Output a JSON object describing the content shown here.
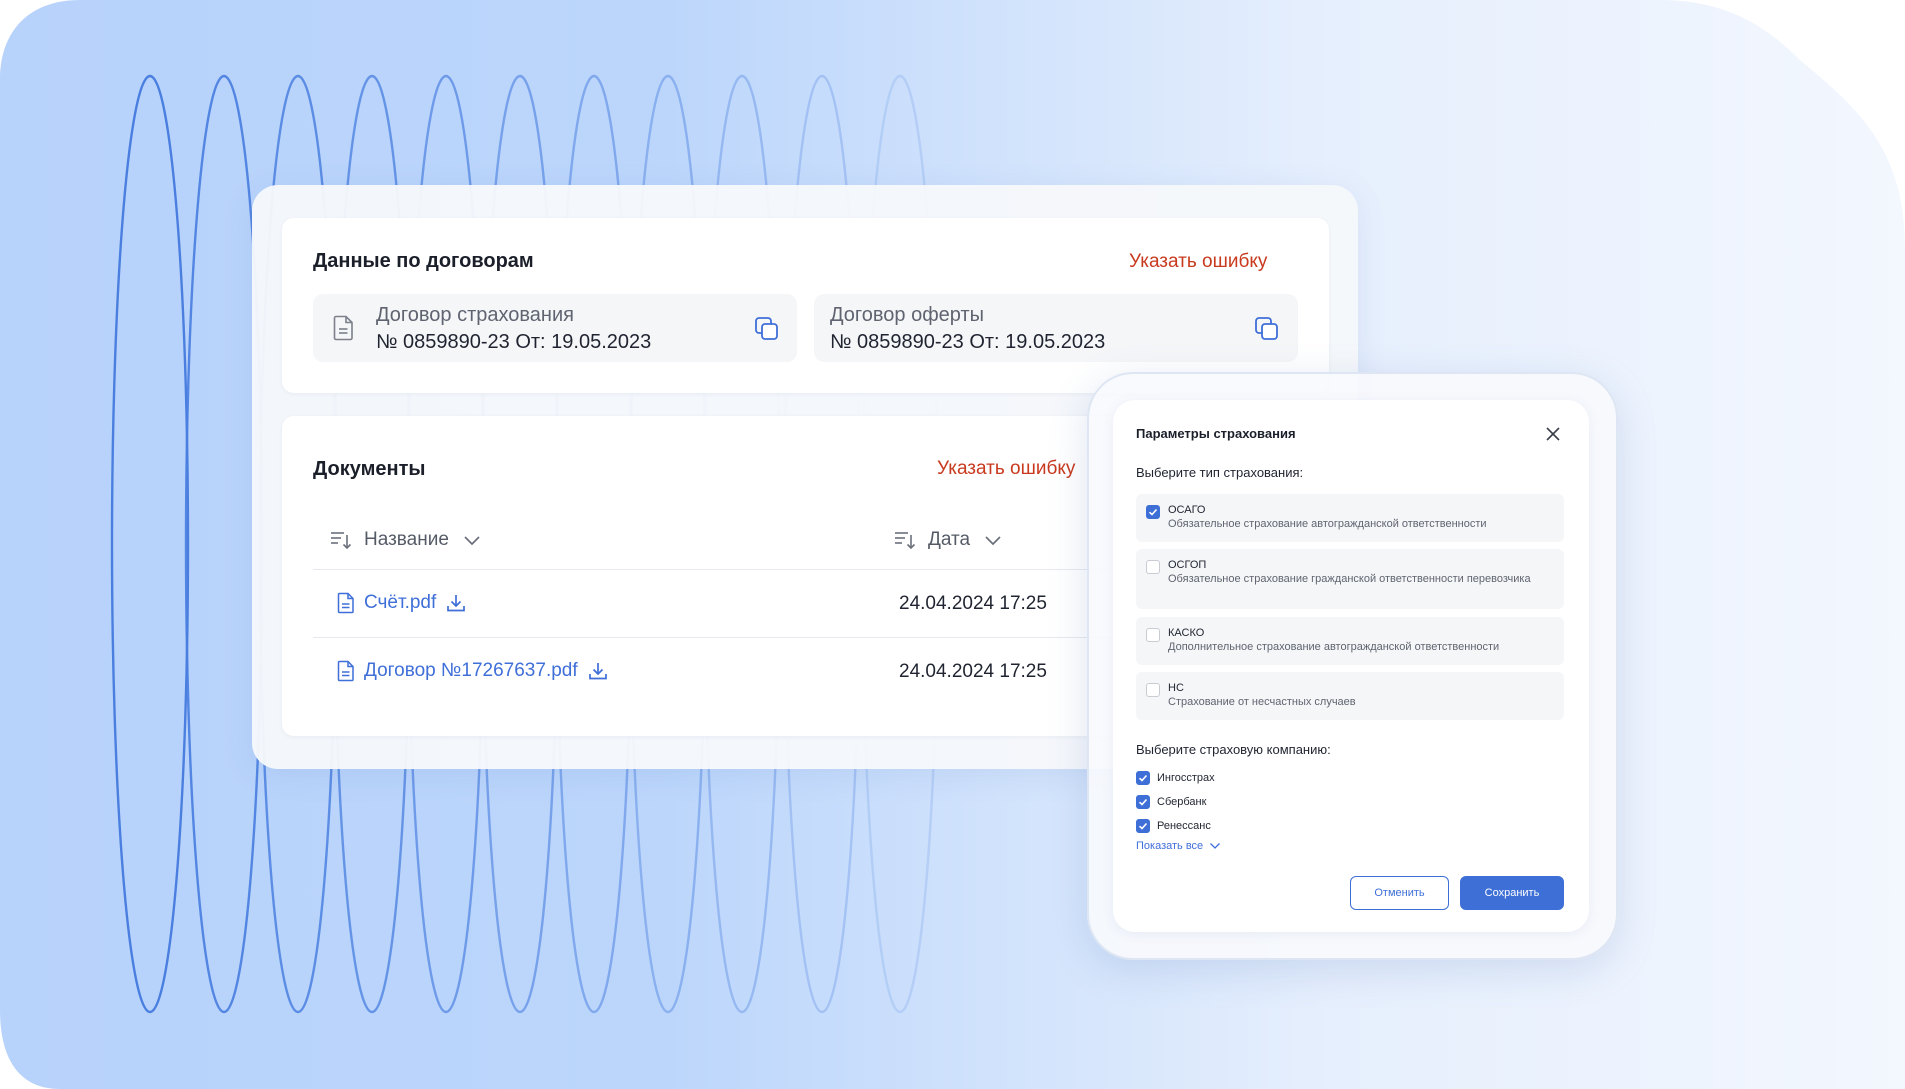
{
  "theme": {
    "accent": "#3d6fd6",
    "link": "#3f6fd8",
    "danger_link": "#c8391e",
    "bg_blue": "#b9d4fb"
  },
  "contracts": {
    "title": "Данные по договорам",
    "report_label": "Указать ошибку",
    "items": [
      {
        "icon": "document-icon",
        "title": "Договор страхования",
        "value": "№ 0859890-23 От: 19.05.2023"
      },
      {
        "title": "Договор оферты",
        "value": "№ 0859890-23 От: 19.05.2023"
      }
    ]
  },
  "documents": {
    "title": "Документы",
    "report_label": "Указать ошибку",
    "columns": {
      "name": "Название",
      "date": "Дата"
    },
    "rows": [
      {
        "name": "Счёт.pdf",
        "date": "24.04.2024 17:25"
      },
      {
        "name": "Договор №17267637.pdf",
        "date": "24.04.2024 17:25"
      }
    ]
  },
  "modal": {
    "title": "Параметры страхования",
    "type_prompt": "Выберите тип страхования:",
    "types": [
      {
        "name": "ОСАГО",
        "desc": "Обязательное страхование автогражданской ответственности",
        "checked": true
      },
      {
        "name": "ОСГОП",
        "desc": "Обязательное страхование гражданской ответственности перевозчика",
        "checked": false
      },
      {
        "name": "КАСКО",
        "desc": "Дополнительное страхование автогражданской ответственности",
        "checked": false
      },
      {
        "name": "НС",
        "desc": "Страхование от несчастных случаев",
        "checked": false
      }
    ],
    "company_prompt": "Выберите страховую компанию:",
    "companies": [
      {
        "name": "Ингосстрах",
        "checked": true
      },
      {
        "name": "Сбербанк",
        "checked": true
      },
      {
        "name": "Ренессанс",
        "checked": true
      }
    ],
    "show_all": "Показать все",
    "cancel": "Отменить",
    "save": "Сохранить"
  }
}
